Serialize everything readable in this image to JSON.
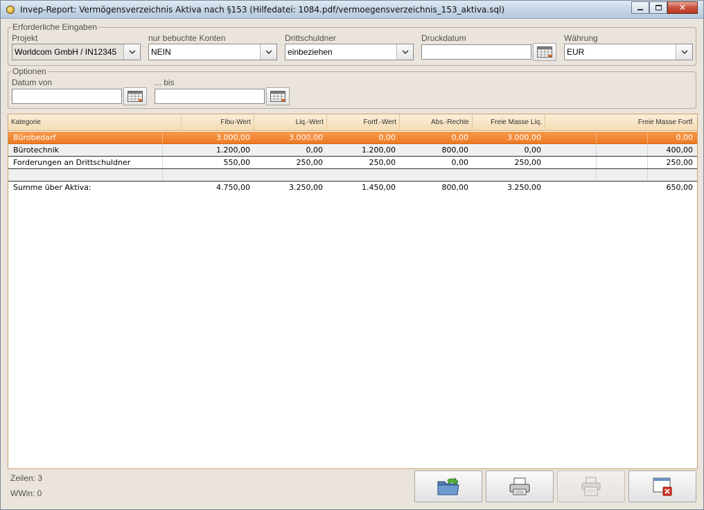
{
  "window": {
    "title": "Invep-Report: Vermögensverzeichnis Aktiva nach §153   (Hilfedatei: 1084.pdf/vermoegensverzeichnis_153_aktiva.sql)",
    "close_glyph": "✕"
  },
  "required": {
    "legend": "Erforderliche Eingaben",
    "projekt": {
      "label": "Projekt",
      "value": "Worldcom GmbH / IN12345"
    },
    "konten": {
      "label": "nur bebuchte Konten",
      "value": "NEIN"
    },
    "drittschuldner": {
      "label": "Drittschuldner",
      "value": "einbeziehen"
    },
    "druckdatum": {
      "label": "Druckdatum",
      "value": ""
    },
    "waehrung": {
      "label": "Währung",
      "value": "EUR"
    }
  },
  "options": {
    "legend": "Optionen",
    "datum_von": {
      "label": "Datum von",
      "value": ""
    },
    "bis": {
      "label": "... bis",
      "value": ""
    }
  },
  "grid": {
    "columns": [
      "Kategorie",
      "Fibu-Wert",
      "Liq.-Wert",
      "Fortf.-Wert",
      "Abs.-Rechte",
      "Freie Masse Liq.",
      "Freie Masse Fortf."
    ],
    "rows": [
      {
        "kategorie": "Bürobedarf",
        "fibu": "3.000,00",
        "liq": "3.000,00",
        "fortf": "0,00",
        "abs": "0,00",
        "fm_liq": "3.000,00",
        "fm_fortf": "0,00",
        "selected": true
      },
      {
        "kategorie": "Bürotechnik",
        "fibu": "1.200,00",
        "liq": "0,00",
        "fortf": "1.200,00",
        "abs": "800,00",
        "fm_liq": "0,00",
        "fm_fortf": "400,00"
      },
      {
        "kategorie": "Forderungen an Drittschuldner",
        "fibu": "550,00",
        "liq": "250,00",
        "fortf": "250,00",
        "abs": "0,00",
        "fm_liq": "250,00",
        "fm_fortf": "250,00"
      },
      {
        "kategorie": "",
        "fibu": "",
        "liq": "",
        "fortf": "",
        "abs": "",
        "fm_liq": "",
        "fm_fortf": ""
      },
      {
        "kategorie": "Summe über Aktiva:",
        "fibu": "4.750,00",
        "liq": "3.250,00",
        "fortf": "1.450,00",
        "abs": "800,00",
        "fm_liq": "3.250,00",
        "fm_fortf": "650,00"
      }
    ]
  },
  "status": {
    "zeilen": "Zeilen: 3",
    "wwin": "WWin: 0"
  },
  "buttons": [
    {
      "icon": "export-folder-icon",
      "enabled": true
    },
    {
      "icon": "print-icon",
      "enabled": true
    },
    {
      "icon": "print-preview-icon",
      "enabled": false
    },
    {
      "icon": "close-window-icon",
      "enabled": true
    }
  ],
  "colors": {
    "selection": "#ee7a24",
    "header_bg": "#f4dcb4",
    "window_bg": "#eae4dc"
  }
}
